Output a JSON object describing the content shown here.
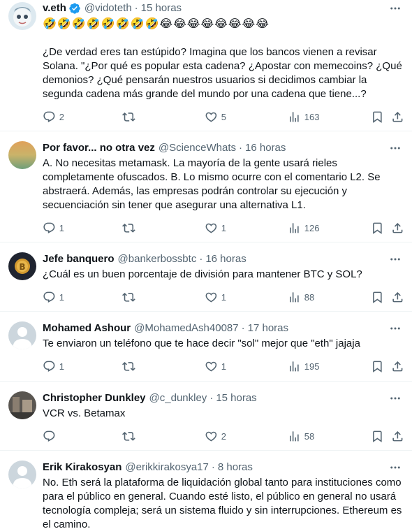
{
  "tweets": [
    {
      "name": "v.eth",
      "handle": "@vidoteth",
      "sep": "·",
      "time": "15 horas",
      "verified": true,
      "emoji_line": "🤣🤣🤣🤣🤣🤣🤣🤣😂😂😂😂😂😂😂😂",
      "text": "¿De verdad eres tan estúpido? Imagina que los bancos vienen a revisar Solana. \"¿Por qué es popular esta cadena? ¿Apostar con memecoins? ¿Qué demonios? ¿Qué pensarán nuestros usuarios si decidimos cambiar la segunda cadena más grande del mundo por una cadena que tiene...?",
      "replies": "2",
      "retweets": "",
      "likes": "5",
      "views": "163",
      "avatar_colors": [
        "#cfe0ea",
        "#8fa8b8"
      ]
    },
    {
      "name": "Por favor... no otra vez",
      "handle": "@ScienceWhats",
      "sep": "·",
      "time": "16 horas",
      "text": "A. No necesitas metamask. La mayoría de la gente usará rieles completamente ofuscados. B. Lo mismo ocurre con el comentario L2. Se abstraerá. Además, las empresas podrán controlar su ejecución y secuenciación sin tener que asegurar una alternativa L1.",
      "replies": "1",
      "retweets": "",
      "likes": "1",
      "views": "126",
      "avatar_colors": [
        "#e8a54a",
        "#7aa37a"
      ]
    },
    {
      "name": "Jefe banquero",
      "handle": "@bankerbossbtc",
      "sep": "·",
      "time": "16 horas",
      "text": "¿Cuál es un buen porcentaje de división para mantener BTC y SOL?",
      "replies": "1",
      "retweets": "",
      "likes": "1",
      "views": "88",
      "avatar_colors": [
        "#2a2f3a",
        "#d8a23a"
      ]
    },
    {
      "name": "Mohamed Ashour",
      "handle": "@MohamedAsh40087",
      "sep": "·",
      "time": "17 horas",
      "text": "Te enviaron un teléfono que te hace decir \"sol\" mejor que \"eth\" jajaja",
      "replies": "1",
      "retweets": "",
      "likes": "1",
      "views": "195",
      "avatar_colors": [
        "#ccd6dd",
        "#ffffff"
      ]
    },
    {
      "name": "Christopher Dunkley",
      "handle": "@c_dunkley",
      "sep": "·",
      "time": "15 horas",
      "text": "VCR vs. Betamax",
      "replies": "",
      "retweets": "",
      "likes": "2",
      "views": "58",
      "avatar_colors": [
        "#4a4a4a",
        "#9a8a7a"
      ]
    },
    {
      "name": "Erik Kirakosyan",
      "handle": "@erikkirakosya17",
      "sep": "·",
      "time": "8 horas",
      "text": "No. Eth será la plataforma de liquidación global tanto para instituciones como para el público en general. Cuando esté listo, el público en general no usará tecnología compleja; será un sistema fluido y sin interrupciones. Ethereum es el camino.",
      "replies": "",
      "retweets": "",
      "likes": "",
      "views": "",
      "avatar_colors": [
        "#ccd6dd",
        "#ffffff"
      ]
    }
  ]
}
